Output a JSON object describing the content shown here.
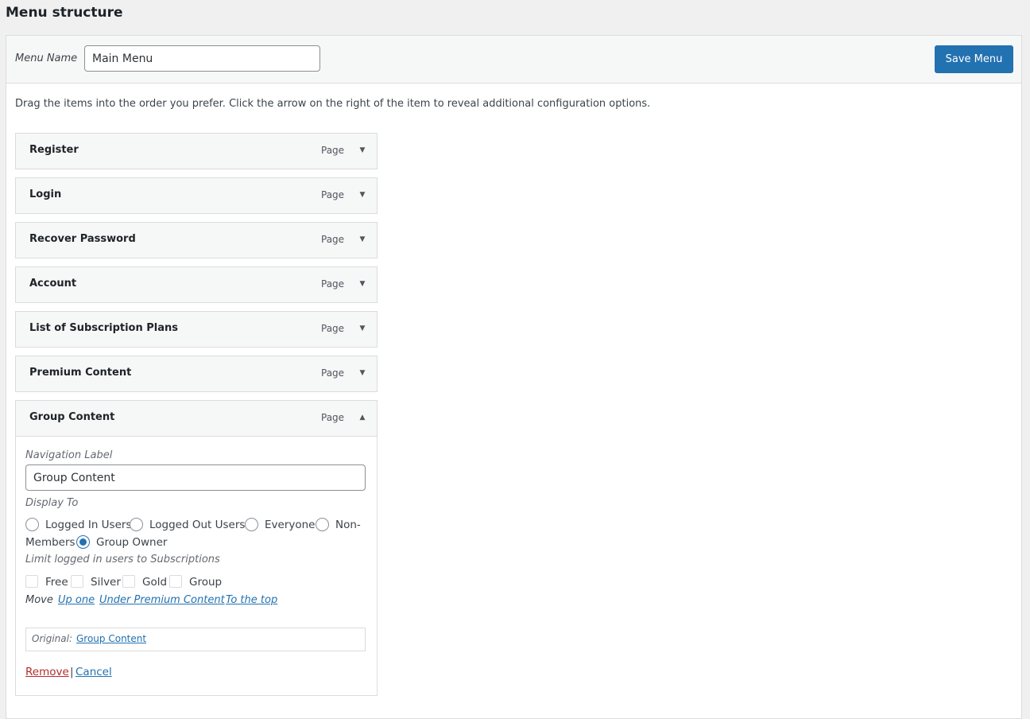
{
  "page_title": "Menu structure",
  "header": {
    "menu_name_label": "Menu Name",
    "menu_name_value": "Main Menu",
    "save_label": "Save Menu"
  },
  "instructions": "Drag the items into the order you prefer. Click the arrow on the right of the item to reveal additional configuration options.",
  "items": [
    {
      "title": "Register",
      "type": "Page",
      "expanded": false
    },
    {
      "title": "Login",
      "type": "Page",
      "expanded": false
    },
    {
      "title": "Recover Password",
      "type": "Page",
      "expanded": false
    },
    {
      "title": "Account",
      "type": "Page",
      "expanded": false
    },
    {
      "title": "List of Subscription Plans",
      "type": "Page",
      "expanded": false
    },
    {
      "title": "Premium Content",
      "type": "Page",
      "expanded": false
    },
    {
      "title": "Group Content",
      "type": "Page",
      "expanded": true
    }
  ],
  "settings": {
    "nav_label_caption": "Navigation Label",
    "nav_label_value": "Group Content",
    "display_to_caption": "Display To",
    "display_options": {
      "logged_in": "Logged In Users",
      "logged_out": "Logged Out Users",
      "everyone": "Everyone",
      "non_members_part1": "Non-",
      "non_members_part2": "Members",
      "group_owner": "Group Owner"
    },
    "display_selected": "Group Owner",
    "limit_caption": "Limit logged in users to Subscriptions",
    "subscriptions": [
      "Free",
      "Silver",
      "Gold",
      "Group"
    ],
    "move_caption": "Move",
    "move_links": [
      "Up one",
      "Under Premium Content",
      "To the top"
    ],
    "original_caption": "Original:",
    "original_link": "Group Content",
    "remove_label": "Remove",
    "separator": "|",
    "cancel_label": "Cancel"
  }
}
